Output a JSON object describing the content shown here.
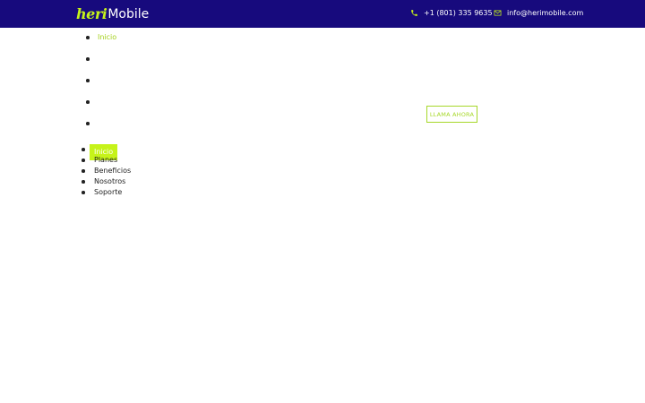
{
  "header": {
    "logo_part1": "heri",
    "logo_part2": "Mobile",
    "phone": "+1 (801) 335 9635",
    "email": "info@herimobile.com",
    "phone_icon": "phone-icon",
    "email_icon": "envelope-icon"
  },
  "nav_top": {
    "items": [
      {
        "label": "Inicio",
        "active": true
      },
      {
        "label": ""
      },
      {
        "label": ""
      },
      {
        "label": ""
      },
      {
        "label": ""
      }
    ]
  },
  "cta": {
    "label": "LLAMA AHORA"
  },
  "nav_bottom": {
    "items": [
      {
        "label": "Inicio",
        "active": true
      },
      {
        "label": "Planes"
      },
      {
        "label": "Beneficios"
      },
      {
        "label": "Nosotros"
      },
      {
        "label": "Soporte"
      }
    ]
  },
  "colors": {
    "header_bg": "#170a7d",
    "accent": "#c6f31a",
    "text": "#222222"
  }
}
